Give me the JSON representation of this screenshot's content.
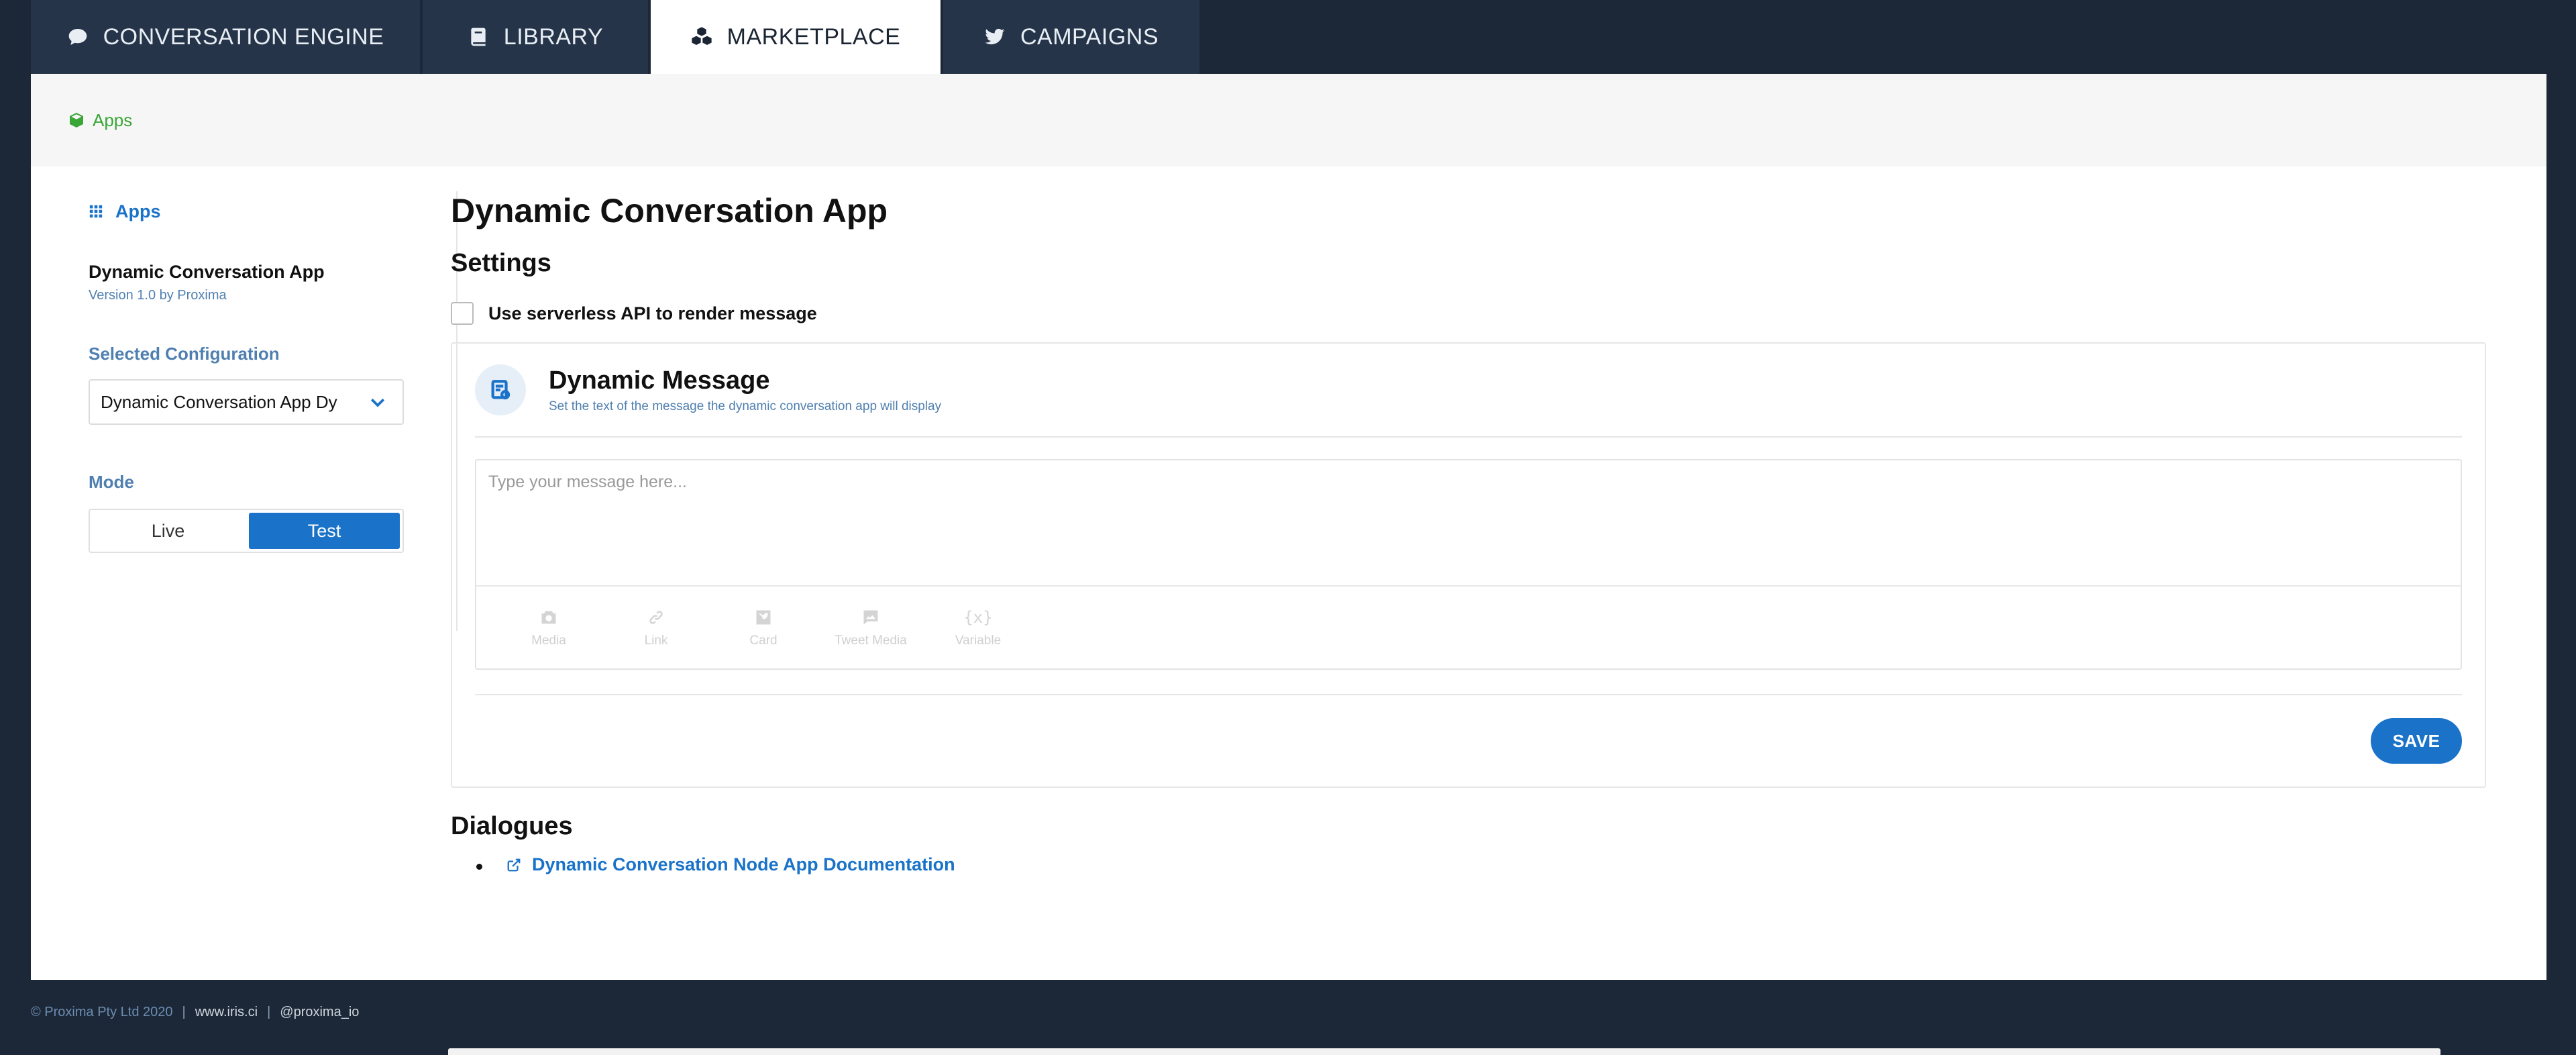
{
  "tabs": [
    {
      "label": "CONVERSATION ENGINE",
      "icon": "chat-bubble-icon",
      "active": false
    },
    {
      "label": "LIBRARY",
      "icon": "book-icon",
      "active": false
    },
    {
      "label": "MARKETPLACE",
      "icon": "cubes-icon",
      "active": true
    },
    {
      "label": "CAMPAIGNS",
      "icon": "twitter-icon",
      "active": false
    }
  ],
  "breadcrumb": {
    "label": "Apps",
    "icon": "cube-icon"
  },
  "sidebar": {
    "apps_link": "Apps",
    "app_name": "Dynamic Conversation App",
    "version": "Version 1.0 by Proxima",
    "config_label": "Selected Configuration",
    "config_value": "Dynamic Conversation App Dy",
    "mode_label": "Mode",
    "mode_options": [
      "Live",
      "Test"
    ],
    "mode_selected": "Test"
  },
  "main": {
    "title": "Dynamic Conversation App",
    "settings_heading": "Settings",
    "serverless_checkbox_label": "Use serverless API to render message",
    "serverless_checked": false,
    "card": {
      "title": "Dynamic Message",
      "subtitle": "Set the text of the message the dynamic conversation app will display",
      "placeholder": "Type your message here...",
      "tools": [
        {
          "label": "Media",
          "icon": "camera-icon"
        },
        {
          "label": "Link",
          "icon": "link-icon"
        },
        {
          "label": "Card",
          "icon": "twitter-card-icon"
        },
        {
          "label": "Tweet Media",
          "icon": "image-message-icon"
        },
        {
          "label": "Variable",
          "icon": "variable-icon",
          "glyph": "{x}"
        }
      ],
      "save_label": "SAVE"
    },
    "dialogues_heading": "Dialogues",
    "doc_link": "Dynamic Conversation Node App Documentation"
  },
  "footer": {
    "copyright": "© Proxima Pty Ltd 2020",
    "separator": "|",
    "site": "www.iris.ci",
    "handle": "@proxima_io"
  },
  "colors": {
    "background": "#1c2838",
    "tab_inactive": "#253448",
    "accent": "#1a73c9",
    "breadcrumb_green": "#3aa637",
    "muted_blue": "#4f7fb0"
  }
}
